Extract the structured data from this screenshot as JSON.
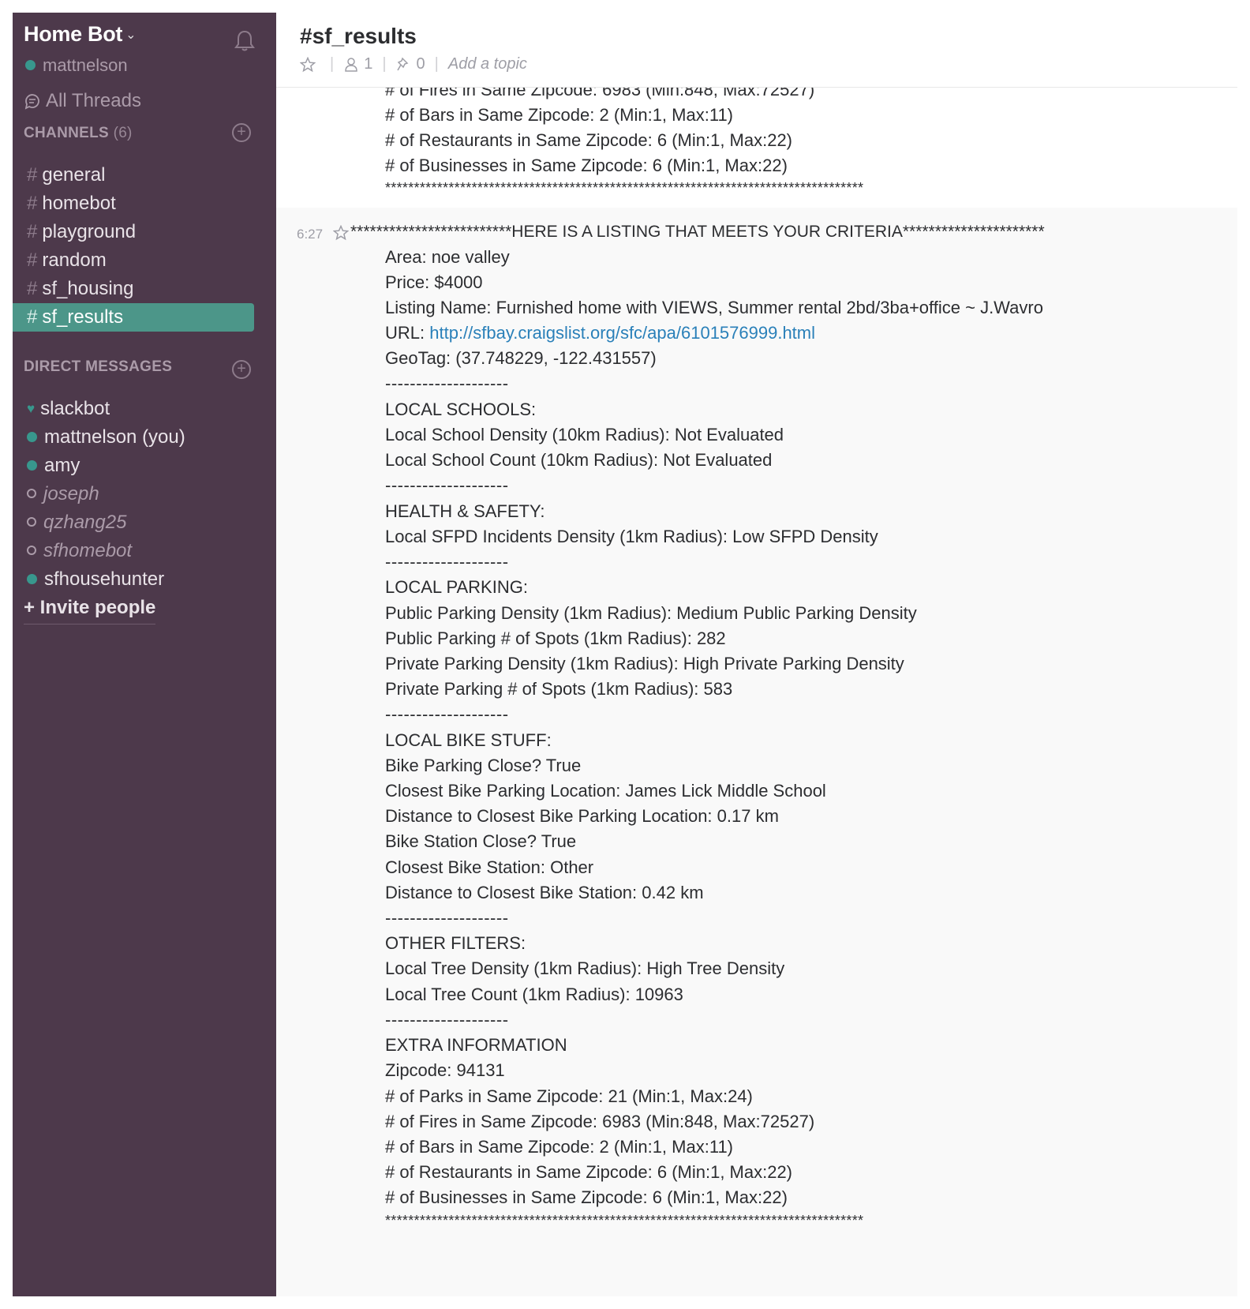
{
  "sidebar": {
    "team_name": "Home Bot",
    "team_chevron": "⌄",
    "current_user": "mattnelson",
    "all_threads": "All Threads",
    "channels_header": "CHANNELS",
    "channels_count": "(6)",
    "channels": [
      {
        "name": "general",
        "active": false
      },
      {
        "name": "homebot",
        "active": false
      },
      {
        "name": "playground",
        "active": false
      },
      {
        "name": "random",
        "active": false
      },
      {
        "name": "sf_housing",
        "active": false
      },
      {
        "name": "sf_results",
        "active": true
      }
    ],
    "hash": "#",
    "plus": "+",
    "dm_header": "DIRECT MESSAGES",
    "direct_messages": [
      {
        "name": "slackbot",
        "status": "bot"
      },
      {
        "name": "mattnelson (you)",
        "status": "online"
      },
      {
        "name": "amy",
        "status": "online"
      },
      {
        "name": "joseph",
        "status": "away"
      },
      {
        "name": "qzhang25",
        "status": "away"
      },
      {
        "name": "sfhomebot",
        "status": "away"
      },
      {
        "name": "sfhousehunter",
        "status": "online"
      }
    ],
    "invite": "+ Invite people"
  },
  "header": {
    "channel_title": "#sf_results",
    "members_count": "1",
    "pins_count": "0",
    "separator": "|",
    "topic_placeholder": "Add a topic"
  },
  "previous_message": {
    "lines": [
      "# of Fires in Same Zipcode: 6983 (Min:848, Max:72527)",
      "# of Bars in Same Zipcode: 2 (Min:1, Max:11)",
      "# of Restaurants in Same Zipcode: 6 (Min:1, Max:22)",
      "# of Businesses in Same Zipcode: 6 (Min:1, Max:22)",
      "***********************************************************************************"
    ]
  },
  "message": {
    "timestamp": "6:27",
    "header": "*************************HERE IS A LISTING THAT MEETS YOUR CRITERIA**********************",
    "area": "Area: noe valley",
    "price": "Price: $4000",
    "listing_name": "Listing Name: Furnished home with VIEWS, Summer rental 2bd/3ba+office ~ J.Wavro",
    "url_label": "URL: ",
    "url": "http://sfbay.craigslist.org/sfc/apa/6101576999.html",
    "geotag": "GeoTag: (37.748229, -122.431557)",
    "divider": "--------------------",
    "schools_header": "LOCAL SCHOOLS:",
    "school_density": "Local School Density (10km Radius): Not Evaluated",
    "school_count": "Local School Count (10km Radius): Not Evaluated",
    "health_header": "HEALTH & SAFETY:",
    "sfpd_density": "Local SFPD Incidents Density (1km Radius): Low SFPD Density",
    "parking_header": "LOCAL PARKING:",
    "public_parking_density": "Public Parking Density (1km Radius): Medium Public Parking Density",
    "public_parking_spots": "Public Parking # of Spots (1km Radius): 282",
    "private_parking_density": "Private Parking Density (1km Radius): High Private Parking Density",
    "private_parking_spots": "Private Parking # of Spots (1km Radius): 583",
    "bike_header": "LOCAL BIKE STUFF:",
    "bike_parking_close": "Bike Parking Close? True",
    "closest_bike_parking": "Closest Bike Parking Location: James Lick Middle School",
    "distance_bike_parking": "Distance to Closest Bike Parking Location: 0.17 km",
    "bike_station_close": "Bike Station Close? True",
    "closest_bike_station": "Closest Bike Station: Other",
    "distance_bike_station": "Distance to Closest Bike Station: 0.42 km",
    "other_header": "OTHER FILTERS:",
    "tree_density": "Local Tree Density (1km Radius): High Tree Density",
    "tree_count": "Local Tree Count (1km Radius): 10963",
    "extra_header": "EXTRA INFORMATION",
    "zipcode": "Zipcode: 94131",
    "parks": "# of Parks in Same Zipcode: 21 (Min:1, Max:24)",
    "fires": "# of Fires in Same Zipcode: 6983 (Min:848, Max:72527)",
    "bars": "# of Bars in Same Zipcode: 2 (Min:1, Max:11)",
    "restaurants": "# of Restaurants in Same Zipcode: 6 (Min:1, Max:22)",
    "businesses": "# of Businesses in Same Zipcode: 6 (Min:1, Max:22)",
    "footer": "***********************************************************************************"
  },
  "colors": {
    "sidebar_bg": "#4d394b",
    "active_channel": "#4c9689",
    "presence_online": "#38978d",
    "link": "#2a80b9"
  }
}
